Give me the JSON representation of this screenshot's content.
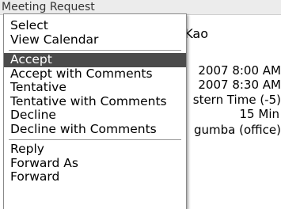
{
  "window": {
    "title": "Meeting Request"
  },
  "background": {
    "organizer": "Rob Kao",
    "start": "2007 8:00 AM",
    "end": "2007 8:30 AM",
    "timezone": "stern Time (-5)",
    "reminder": "15 Min",
    "location": "gumba (office)"
  },
  "menu": {
    "group1": [
      {
        "label": "Select"
      },
      {
        "label": "View Calendar"
      }
    ],
    "group2": [
      {
        "label": "Accept",
        "selected": true
      },
      {
        "label": "Accept with Comments"
      },
      {
        "label": "Tentative"
      },
      {
        "label": "Tentative with Comments"
      },
      {
        "label": "Decline"
      },
      {
        "label": "Decline with Comments"
      }
    ],
    "group3": [
      {
        "label": "Reply"
      },
      {
        "label": "Forward As"
      },
      {
        "label": "Forward"
      }
    ]
  },
  "colors": {
    "highlight": "#4b4b4b",
    "menu_background": "#ffffff",
    "title_bar": "#ececec"
  }
}
